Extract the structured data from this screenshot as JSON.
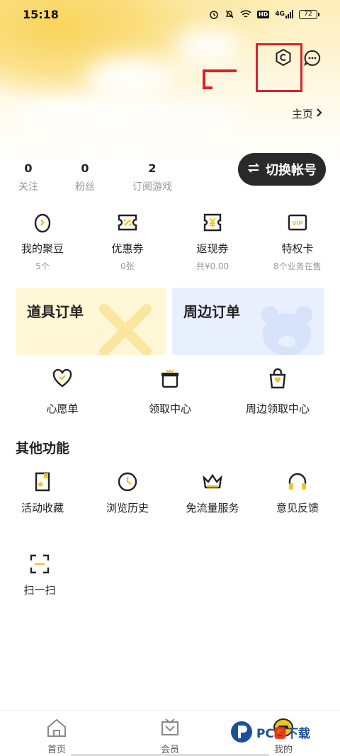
{
  "status_bar": {
    "time": "15:18",
    "battery": "72",
    "icons": [
      "alarm-icon",
      "mute-icon",
      "wifi-icon",
      "hd-icon",
      "signal-icon",
      "battery-icon"
    ],
    "hd_label": "HD",
    "network_label": "4G"
  },
  "header": {
    "homepage_label": "主页",
    "icons": [
      "coin-icon",
      "message-icon"
    ]
  },
  "stats": [
    {
      "value": "0",
      "label": "关注"
    },
    {
      "value": "0",
      "label": "粉丝"
    },
    {
      "value": "2",
      "label": "订阅游戏"
    }
  ],
  "switch_account_label": "切换帐号",
  "wallet": [
    {
      "label": "我的聚豆",
      "sub": "5个",
      "icon": "bean-icon"
    },
    {
      "label": "优惠券",
      "sub": "0张",
      "icon": "coupon-icon"
    },
    {
      "label": "返现券",
      "sub": "共¥0.00",
      "icon": "cashback-icon"
    },
    {
      "label": "特权卡",
      "sub": "8个业务在售",
      "icon": "vip-card-icon"
    }
  ],
  "orders": [
    {
      "label": "道具订单",
      "color": "#fff7d6"
    },
    {
      "label": "周边订单",
      "color": "#e8effd"
    }
  ],
  "services": [
    {
      "label": "心愿单",
      "icon": "heart-icon"
    },
    {
      "label": "领取中心",
      "icon": "gift-icon"
    },
    {
      "label": "周边领取中心",
      "icon": "bag-icon"
    }
  ],
  "other_title": "其他功能",
  "other_functions": [
    {
      "label": "活动收藏",
      "icon": "bookmark-icon"
    },
    {
      "label": "浏览历史",
      "icon": "clock-icon"
    },
    {
      "label": "免流量服务",
      "icon": "crown-icon"
    },
    {
      "label": "意见反馈",
      "icon": "headset-icon"
    },
    {
      "label": "扫一扫",
      "icon": "scan-icon"
    }
  ],
  "bottom_nav": [
    {
      "label": "首页",
      "icon": "home-icon"
    },
    {
      "label": "会员",
      "icon": "member-icon"
    },
    {
      "label": "我的",
      "icon": "profile-icon"
    }
  ],
  "accent_color": "#f5c21b",
  "watermark": {
    "prefix": "PC",
    "suffix": "下载"
  }
}
